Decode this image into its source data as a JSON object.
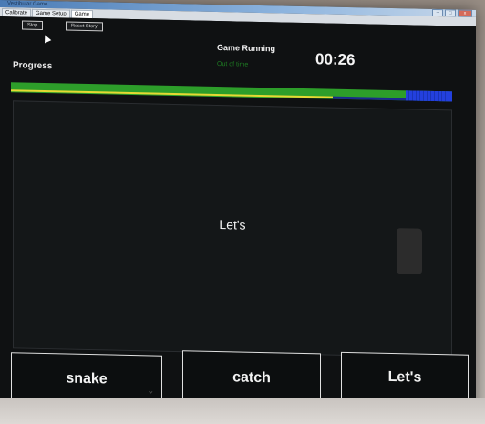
{
  "window": {
    "title": "Vestibular Game",
    "controls": [
      "–",
      "□",
      "x"
    ]
  },
  "tabs": [
    {
      "label": "Calibrate"
    },
    {
      "label": "Game Setup"
    },
    {
      "label": "Game",
      "active": true
    }
  ],
  "toolbar": {
    "stop_label": "Stop",
    "reset_story_label": "Reset Story"
  },
  "progress": {
    "label": "Progress",
    "green_fraction": 0.92,
    "yellow_fraction": 0.73,
    "blue_fraction": 0.105,
    "colors": {
      "green": "#2d9e2a",
      "yellow": "#e5d933",
      "blue": "#1f3fd6"
    }
  },
  "status": {
    "title": "Game Running",
    "subtitle": "Out of time"
  },
  "timer": "00:26",
  "stage": {
    "word": "Let's"
  },
  "choices": [
    {
      "label": "snake"
    },
    {
      "label": "catch"
    },
    {
      "label": "Let's"
    }
  ]
}
